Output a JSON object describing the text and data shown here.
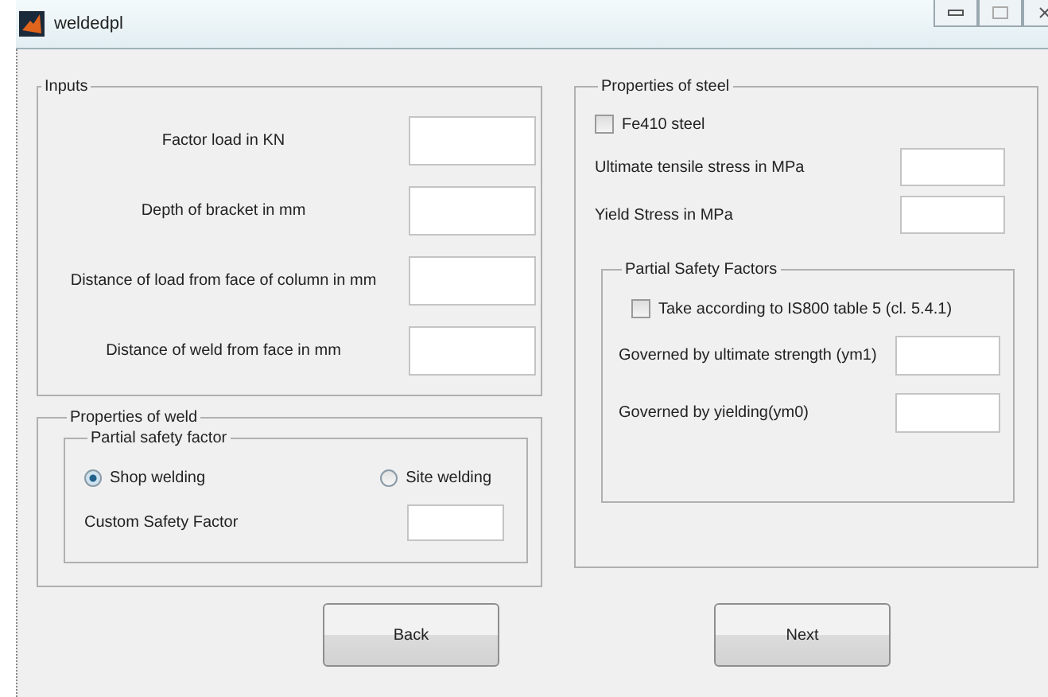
{
  "window": {
    "title": "weldedpl"
  },
  "inputs": {
    "title": "Inputs",
    "fields": [
      {
        "label": "Factor load in KN"
      },
      {
        "label": "Depth of bracket in mm"
      },
      {
        "label": "Distance of load from face of column in mm"
      },
      {
        "label": "Distance of weld from face in mm"
      }
    ]
  },
  "weld": {
    "title": "Properties of weld",
    "group": {
      "title": "Partial safety factor",
      "options": [
        {
          "label": "Shop welding",
          "selected": true
        },
        {
          "label": "Site welding",
          "selected": false
        }
      ],
      "custom_label": "Custom Safety Factor"
    }
  },
  "steel": {
    "title": "Properties of steel",
    "grade": {
      "label": "Fe410 steel",
      "checked": false
    },
    "fields": [
      {
        "label": "Ultimate tensile stress in MPa"
      },
      {
        "label": "Yield Stress in MPa"
      }
    ],
    "safety": {
      "title": "Partial Safety Factors",
      "standard": {
        "label": "Take according to IS800 table 5 (cl. 5.4.1)",
        "checked": false
      },
      "fields": [
        {
          "label": "Governed by ultimate strength (ym1)"
        },
        {
          "label": "Governed by yielding(ym0)"
        }
      ]
    }
  },
  "buttons": [
    {
      "label": "Back"
    },
    {
      "label": "Next"
    }
  ]
}
